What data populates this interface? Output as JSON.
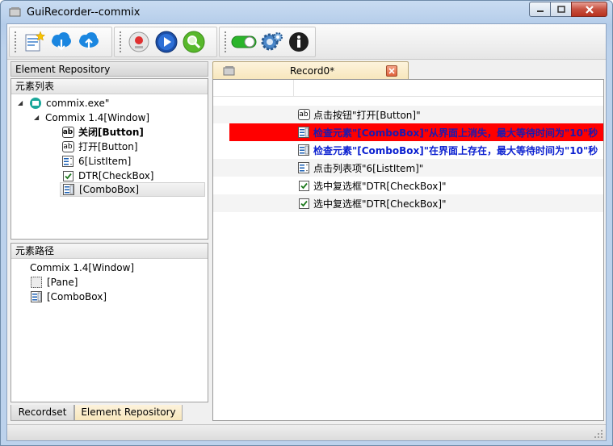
{
  "window": {
    "title": "GuiRecorder--commix"
  },
  "left": {
    "repo_title": "Element Repository",
    "element_list": {
      "header": "元素列表",
      "items": [
        {
          "label": "commix.exe\"",
          "icon": "app-icon",
          "bold": false
        },
        {
          "label": "Commix 1.4[Window]",
          "icon": "",
          "bold": false
        },
        {
          "label": "关闭[Button]",
          "icon": "button-icon",
          "bold": true
        },
        {
          "label": "打开[Button]",
          "icon": "button-icon",
          "bold": false
        },
        {
          "label": "6[ListItem]",
          "icon": "listitem-icon",
          "bold": false
        },
        {
          "label": "DTR[CheckBox]",
          "icon": "checkbox-icon",
          "bold": false
        },
        {
          "label": "[ComboBox]",
          "icon": "combobox-icon",
          "bold": false
        }
      ]
    },
    "element_path": {
      "header": "元素路径",
      "items": [
        {
          "label": "Commix 1.4[Window]"
        },
        {
          "label": "[Pane]"
        },
        {
          "label": "[ComboBox]"
        }
      ]
    },
    "tabs": [
      {
        "label": "Recordset",
        "active": false
      },
      {
        "label": "Element Repository",
        "active": true
      }
    ]
  },
  "record": {
    "tab_label": "Record0*",
    "rows": [
      {
        "text": "点击按钮\"打开[Button]\"",
        "icon": "button-icon",
        "style": "normal"
      },
      {
        "text": "检查元素\"[ComboBox]\"从界面上消失，最大等待时间为\"10\"秒",
        "icon": "combobox-icon",
        "style": "error"
      },
      {
        "text": "检查元素\"[ComboBox]\"在界面上存在，最大等待时间为\"10\"秒",
        "icon": "combobox-icon",
        "style": "blue"
      },
      {
        "text": "点击列表项\"6[ListItem]\"",
        "icon": "listitem-icon",
        "style": "normal"
      },
      {
        "text": "选中复选框\"DTR[CheckBox]\"",
        "icon": "checkbox-icon",
        "style": "normal"
      },
      {
        "text": "选中复选框\"DTR[CheckBox]\"",
        "icon": "checkbox-icon",
        "style": "normal"
      }
    ]
  },
  "colors": {
    "error_highlight": "#ff0000",
    "blue_text": "#0a1fd0",
    "tab_active": "#f7e6bb"
  }
}
